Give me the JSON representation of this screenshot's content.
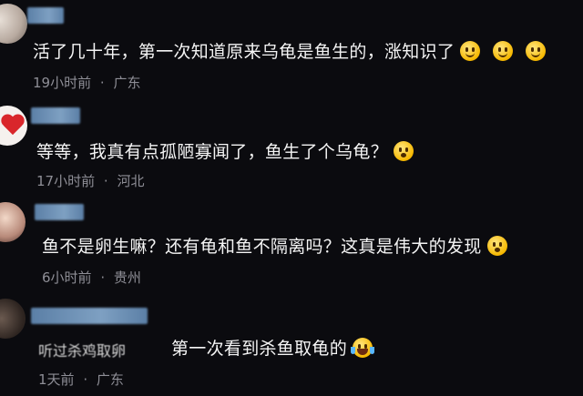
{
  "comments": [
    {
      "text": "活了几十年，第一次知道原来乌龟是鱼生的，涨知识了",
      "time": "19小时前",
      "location": "广东",
      "emojis": [
        "smile-emoji",
        "smile-emoji",
        "smile-emoji"
      ]
    },
    {
      "text": "等等，我真有点孤陋寡闻了，鱼生了个乌龟？",
      "time": "17小时前",
      "location": "河北",
      "emojis": [
        "surprised-emoji"
      ]
    },
    {
      "text": "鱼不是卵生嘛？还有龟和鱼不隔离吗？这真是伟大的发现",
      "time": "6小时前",
      "location": "贵州",
      "emojis": [
        "surprised-emoji"
      ]
    },
    {
      "prefix": "听过杀鸡取卵",
      "text": "第一次看到杀鱼取龟的",
      "time": "1天前",
      "location": "广东",
      "emojis": [
        "laugh-cry-emoji"
      ]
    }
  ],
  "separator": "·"
}
